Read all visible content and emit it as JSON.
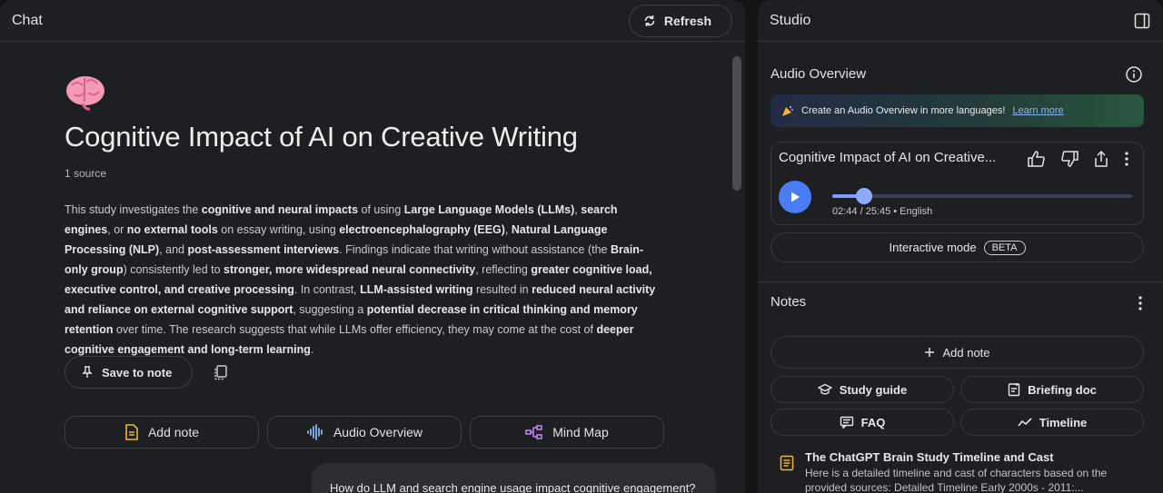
{
  "chat": {
    "title": "Chat",
    "refresh_label": "Refresh",
    "notebook_title": "Cognitive Impact of AI on Creative Writing",
    "source_count": "1 source",
    "summary_segments": [
      {
        "t": "This study investigates the ",
        "b": false
      },
      {
        "t": "cognitive and neural impacts",
        "b": true
      },
      {
        "t": " of using ",
        "b": false
      },
      {
        "t": "Large Language Models (LLMs)",
        "b": true
      },
      {
        "t": ", ",
        "b": false
      },
      {
        "t": "search engines",
        "b": true
      },
      {
        "t": ", or ",
        "b": false
      },
      {
        "t": "no external tools",
        "b": true
      },
      {
        "t": " on essay writing, using ",
        "b": false
      },
      {
        "t": "electroencephalography (EEG)",
        "b": true
      },
      {
        "t": ", ",
        "b": false
      },
      {
        "t": "Natural Language Processing (NLP)",
        "b": true
      },
      {
        "t": ", and ",
        "b": false
      },
      {
        "t": "post-assessment interviews",
        "b": true
      },
      {
        "t": ". Findings indicate that writing without assistance (the ",
        "b": false
      },
      {
        "t": "Brain-only group",
        "b": true
      },
      {
        "t": ") consistently led to ",
        "b": false
      },
      {
        "t": "stronger, more widespread neural connectivity",
        "b": true
      },
      {
        "t": ", reflecting ",
        "b": false
      },
      {
        "t": "greater cognitive load, executive control, and creative processing",
        "b": true
      },
      {
        "t": ". In contrast, ",
        "b": false
      },
      {
        "t": "LLM-assisted writing",
        "b": true
      },
      {
        "t": " resulted in ",
        "b": false
      },
      {
        "t": "reduced neural activity and reliance on external cognitive support",
        "b": true
      },
      {
        "t": ", suggesting a ",
        "b": false
      },
      {
        "t": "potential decrease in critical thinking and memory retention",
        "b": true
      },
      {
        "t": " over time. The research suggests that while LLMs offer efficiency, they may come at the cost of ",
        "b": false
      },
      {
        "t": "deeper cognitive engagement and long-term learning",
        "b": true
      },
      {
        "t": ".",
        "b": false
      }
    ],
    "save_to_note_label": "Save to note",
    "suggestion_chips": [
      "Add note",
      "Audio Overview",
      "Mind Map"
    ],
    "user_message": "How do LLM and search engine usage impact cognitive engagement?"
  },
  "studio": {
    "title": "Studio",
    "audio_overview_heading": "Audio Overview",
    "banner_text": "Create an Audio Overview in more languages!",
    "banner_link": "Learn more",
    "audio_title": "Cognitive Impact of AI on Creative...",
    "progress_fraction": 0.107,
    "time_text": "02:44 / 25:45 • English",
    "interactive_label": "Interactive mode",
    "beta_label": "BETA",
    "notes_heading": "Notes",
    "add_note_label": "Add note",
    "grid_buttons": [
      "Study guide",
      "Briefing doc",
      "FAQ",
      "Timeline"
    ],
    "note_title": "The ChatGPT Brain Study Timeline and Cast",
    "note_preview": "Here is a detailed timeline and cast of characters based on the provided sources: Detailed Timeline Early 2000s - 2011:..."
  },
  "colors": {
    "background": "#131416",
    "panel": "#1e1f22",
    "accent_blue": "#4a7cf6",
    "note_icon": "#f2b233",
    "doc_icon": "#f2b233",
    "audio_icon": "#8ab4f8",
    "mindmap_icon": "#c58af9"
  },
  "icons": {
    "refresh": "refresh-icon",
    "panel_toggle": "sidebar-toggle-icon",
    "brain": "brain-emoji-icon",
    "pin": "pin-icon",
    "copy": "copy-icon",
    "info": "info-icon",
    "thumbs_up": "thumbs-up-icon",
    "thumbs_down": "thumbs-down-icon",
    "share": "share-icon",
    "more": "more-vert-icon",
    "play": "play-icon"
  }
}
